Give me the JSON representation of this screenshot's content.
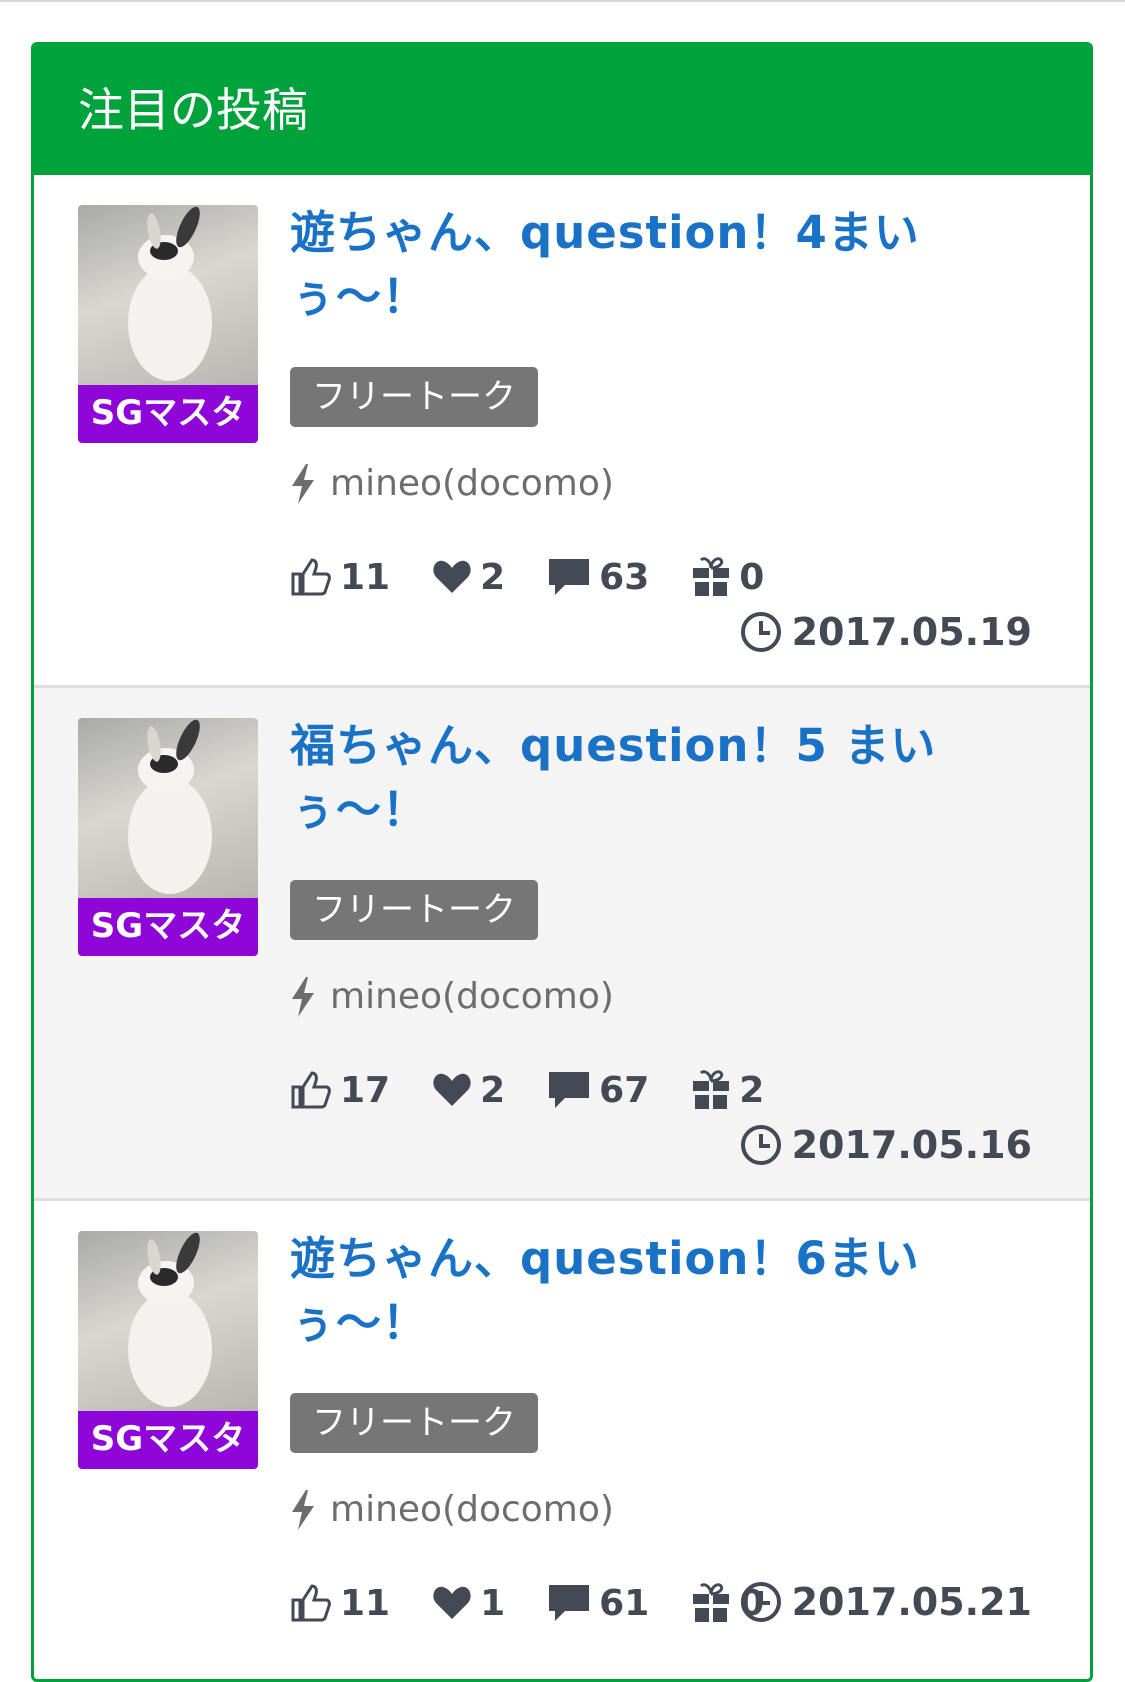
{
  "header": {
    "title": "注目の投稿"
  },
  "colors": {
    "accent": "#00a23c",
    "badge": "#8e06d8",
    "link": "#1a72c7",
    "tag": "#767676"
  },
  "icons": {
    "carrier": "lightning-icon",
    "like": "thumbs-up-icon",
    "favorite": "heart-icon",
    "comments": "comment-icon",
    "gift": "gift-icon",
    "date": "clock-icon"
  },
  "posts": [
    {
      "title": "遊ちゃん、question！4まいぅ〜！",
      "badge": "SGマスタ",
      "category": "フリートーク",
      "carrier": "mineo(docomo)",
      "likes": "11",
      "hearts": "2",
      "comments": "63",
      "gifts": "0",
      "date": "2017.05.19"
    },
    {
      "title": "福ちゃん、question！5 まいぅ〜！",
      "badge": "SGマスタ",
      "category": "フリートーク",
      "carrier": "mineo(docomo)",
      "likes": "17",
      "hearts": "2",
      "comments": "67",
      "gifts": "2",
      "date": "2017.05.16"
    },
    {
      "title": "遊ちゃん、question！6まいぅ〜！",
      "badge": "SGマスタ",
      "category": "フリートーク",
      "carrier": "mineo(docomo)",
      "likes": "11",
      "hearts": "1",
      "comments": "61",
      "gifts": "0",
      "date": "2017.05.21"
    }
  ]
}
